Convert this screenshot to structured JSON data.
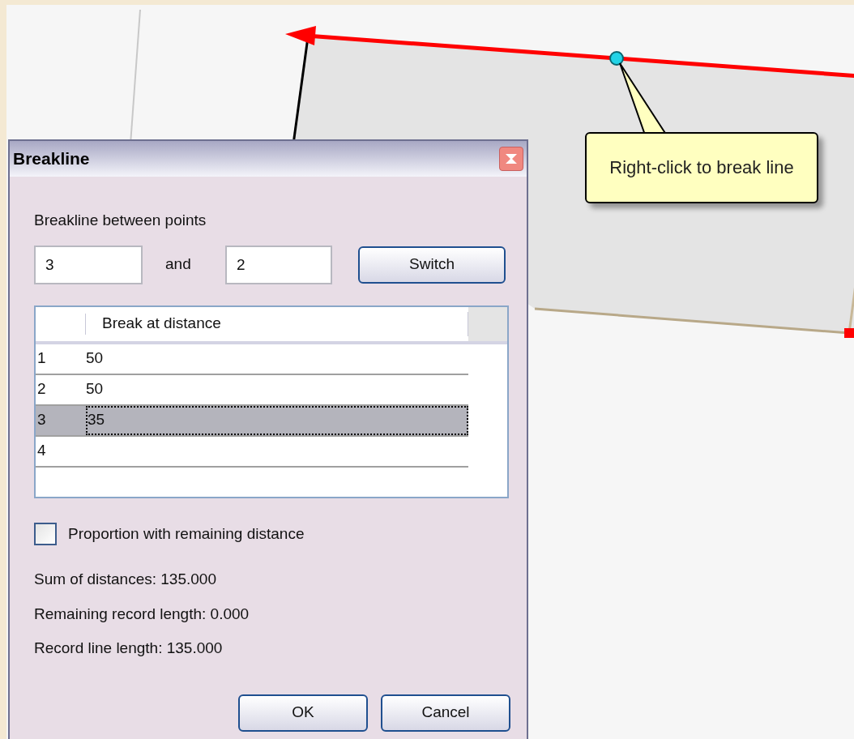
{
  "map": {
    "tooltip": "Right-click to break line"
  },
  "dialog": {
    "title": "Breakline",
    "points_label": "Breakline between points",
    "from_point": "3",
    "connector": "and",
    "to_point": "2",
    "switch_button": "Switch",
    "table": {
      "columns": [
        "Break at distance"
      ],
      "rows": [
        {
          "index": "1",
          "value": "50",
          "selected": false
        },
        {
          "index": "2",
          "value": "50",
          "selected": false
        },
        {
          "index": "3",
          "value": "35",
          "selected": true
        },
        {
          "index": "4",
          "selected": false
        }
      ]
    },
    "proportion": {
      "label": "Proportion with remaining distance",
      "checked": false
    },
    "summary": [
      "Sum of distances: 135.000",
      "Remaining record length: 0.000",
      "Record line length: 135.000"
    ],
    "buttons": [
      "OK",
      "Cancel"
    ]
  }
}
